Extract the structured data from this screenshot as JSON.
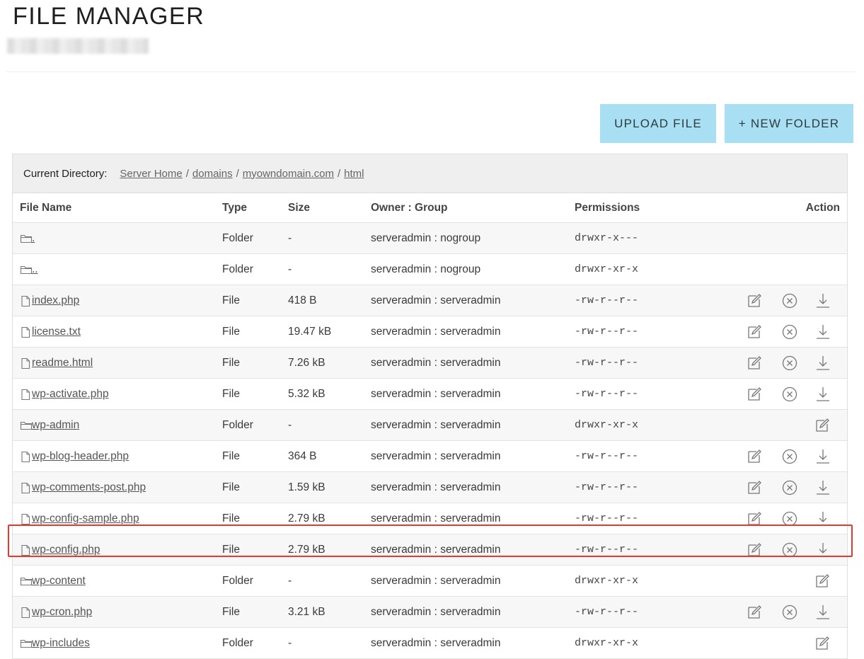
{
  "page": {
    "title": "FILE MANAGER"
  },
  "toolbar": {
    "upload_label": "UPLOAD FILE",
    "new_folder_label": "+ NEW FOLDER"
  },
  "directory": {
    "label": "Current Directory:",
    "path": [
      "Server Home",
      "domains",
      "myowndomain.com",
      "html"
    ]
  },
  "columns": {
    "name": "File Name",
    "type": "Type",
    "size": "Size",
    "owner": "Owner : Group",
    "permissions": "Permissions",
    "action": "Action"
  },
  "rows": [
    {
      "name": ".",
      "type": "Folder",
      "size": "-",
      "owner": "serveradmin : nogroup",
      "permissions": "drwxr-x---",
      "icon": "folder-icon",
      "actions": []
    },
    {
      "name": "..",
      "type": "Folder",
      "size": "-",
      "owner": "serveradmin : nogroup",
      "permissions": "drwxr-xr-x",
      "icon": "folder-icon",
      "actions": []
    },
    {
      "name": "index.php",
      "type": "File",
      "size": "418 B",
      "owner": "serveradmin : serveradmin",
      "permissions": "-rw-r--r--",
      "icon": "file-icon",
      "actions": [
        "edit",
        "delete",
        "download"
      ]
    },
    {
      "name": "license.txt",
      "type": "File",
      "size": "19.47 kB",
      "owner": "serveradmin : serveradmin",
      "permissions": "-rw-r--r--",
      "icon": "file-icon",
      "actions": [
        "edit",
        "delete",
        "download"
      ]
    },
    {
      "name": "readme.html",
      "type": "File",
      "size": "7.26 kB",
      "owner": "serveradmin : serveradmin",
      "permissions": "-rw-r--r--",
      "icon": "file-icon",
      "actions": [
        "edit",
        "delete",
        "download"
      ]
    },
    {
      "name": "wp-activate.php",
      "type": "File",
      "size": "5.32 kB",
      "owner": "serveradmin : serveradmin",
      "permissions": "-rw-r--r--",
      "icon": "file-icon",
      "actions": [
        "edit",
        "delete",
        "download"
      ]
    },
    {
      "name": "wp-admin",
      "type": "Folder",
      "size": "-",
      "owner": "serveradmin : serveradmin",
      "permissions": "drwxr-xr-x",
      "icon": "folder-icon",
      "actions": [
        "rename"
      ]
    },
    {
      "name": "wp-blog-header.php",
      "type": "File",
      "size": "364 B",
      "owner": "serveradmin : serveradmin",
      "permissions": "-rw-r--r--",
      "icon": "file-icon",
      "actions": [
        "edit",
        "delete",
        "download"
      ]
    },
    {
      "name": "wp-comments-post.php",
      "type": "File",
      "size": "1.59 kB",
      "owner": "serveradmin : serveradmin",
      "permissions": "-rw-r--r--",
      "icon": "file-icon",
      "actions": [
        "edit",
        "delete",
        "download"
      ]
    },
    {
      "name": "wp-config-sample.php",
      "type": "File",
      "size": "2.79 kB",
      "owner": "serveradmin : serveradmin",
      "permissions": "-rw-r--r--",
      "icon": "file-icon",
      "actions": [
        "edit",
        "delete",
        "download"
      ]
    },
    {
      "name": "wp-config.php",
      "type": "File",
      "size": "2.79 kB",
      "owner": "serveradmin : serveradmin",
      "permissions": "-rw-r--r--",
      "icon": "file-icon",
      "actions": [
        "edit",
        "delete",
        "download"
      ],
      "highlighted": true
    },
    {
      "name": "wp-content",
      "type": "Folder",
      "size": "-",
      "owner": "serveradmin : serveradmin",
      "permissions": "drwxr-xr-x",
      "icon": "folder-icon",
      "actions": [
        "rename"
      ]
    },
    {
      "name": "wp-cron.php",
      "type": "File",
      "size": "3.21 kB",
      "owner": "serveradmin : serveradmin",
      "permissions": "-rw-r--r--",
      "icon": "file-icon",
      "actions": [
        "edit",
        "delete",
        "download"
      ]
    },
    {
      "name": "wp-includes",
      "type": "Folder",
      "size": "-",
      "owner": "serveradmin : serveradmin",
      "permissions": "drwxr-xr-x",
      "icon": "folder-icon",
      "actions": [
        "rename"
      ]
    }
  ],
  "colors": {
    "button_bg": "#a8dff2",
    "highlight_border": "#e8392c",
    "alt_row_bg": "#f7f7f7",
    "dir_bar_bg": "#efefef"
  }
}
